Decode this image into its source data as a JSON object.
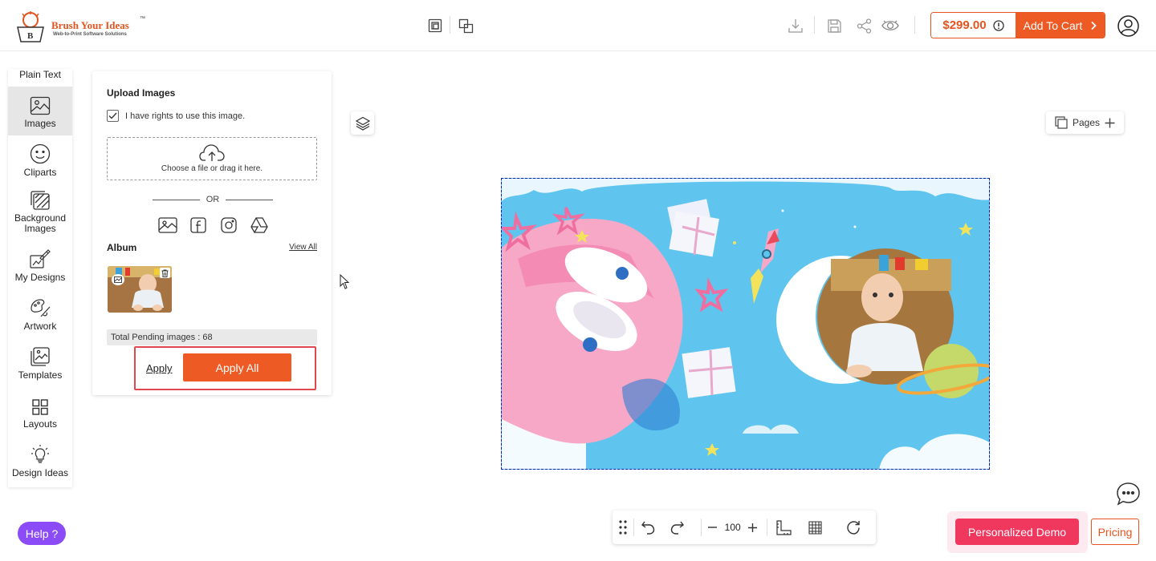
{
  "brand": {
    "name": "Brush Your Ideas",
    "trademark": "™",
    "tagline": "Web-to-Print Software Solutions",
    "color": "#e5541f"
  },
  "header": {
    "icons": [
      "duplicate-page-icon",
      "arrange-icon",
      "download-icon",
      "save-icon",
      "share-icon",
      "preview-icon",
      "info-icon",
      "user-icon"
    ],
    "price": "$299.00",
    "cart_label": "Add To Cart",
    "accent": "#ee5a24"
  },
  "toolbar": {
    "top_label": "Plain Text",
    "items": [
      {
        "label": "Images",
        "icon": "image-icon"
      },
      {
        "label": "Cliparts",
        "icon": "smiley-icon"
      },
      {
        "label": "Background Images",
        "icon": "background-icon"
      },
      {
        "label": "My Designs",
        "icon": "my-designs-icon"
      },
      {
        "label": "Artwork",
        "icon": "artwork-icon"
      },
      {
        "label": "Templates",
        "icon": "templates-icon"
      },
      {
        "label": "Layouts",
        "icon": "layouts-icon"
      },
      {
        "label": "Design Ideas",
        "icon": "bulb-icon"
      }
    ]
  },
  "upload_panel": {
    "title": "Upload Images",
    "rights_label": "I have rights to use this image.",
    "rights_checked": true,
    "dropzone_label": "Choose a file or drag it here.",
    "or_label": "OR",
    "sources": [
      "gallery-icon",
      "facebook-icon",
      "instagram-icon",
      "google-drive-icon"
    ],
    "album_title": "Album",
    "view_all": "View All",
    "pending": "Total Pending images : 68",
    "apply_label": "Apply",
    "apply_all_label": "Apply All"
  },
  "canvas": {
    "pages_label": "Pages"
  },
  "bottom_bar": {
    "zoom": "100"
  },
  "help_label": "Help ?",
  "demo_label": "Personalized Demo",
  "pricing_label": "Pricing"
}
